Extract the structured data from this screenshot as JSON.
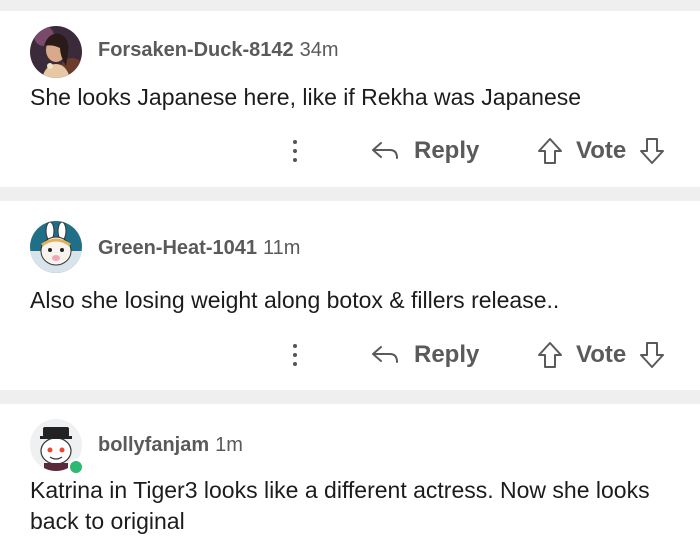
{
  "comments": [
    {
      "username": "Forsaken-Duck-8142",
      "time": "34m",
      "text": "She looks Japanese here, like if Rekha was Japanese",
      "reply_label": "Reply",
      "vote_label": "Vote",
      "avatar_icon": "user-photo-avatar"
    },
    {
      "username": "Green-Heat-1041",
      "time": "11m",
      "text": "Also she losing weight along botox & fillers release..",
      "reply_label": "Reply",
      "vote_label": "Vote",
      "avatar_icon": "bunny-avatar"
    },
    {
      "username": "bollyfanjam",
      "time": "1m",
      "text": "Katrina in Tiger3 looks like a different actress. Now she looks back to original",
      "online": true,
      "avatar_icon": "snoo-avatar"
    }
  ],
  "colors": {
    "background": "#efefef",
    "card": "#ffffff",
    "meta_text": "#5a5a5a",
    "online": "#2eb872"
  },
  "icons": {
    "more": "more-vertical-icon",
    "reply": "reply-arrow-icon",
    "upvote": "upvote-arrow-icon",
    "downvote": "downvote-arrow-icon"
  }
}
